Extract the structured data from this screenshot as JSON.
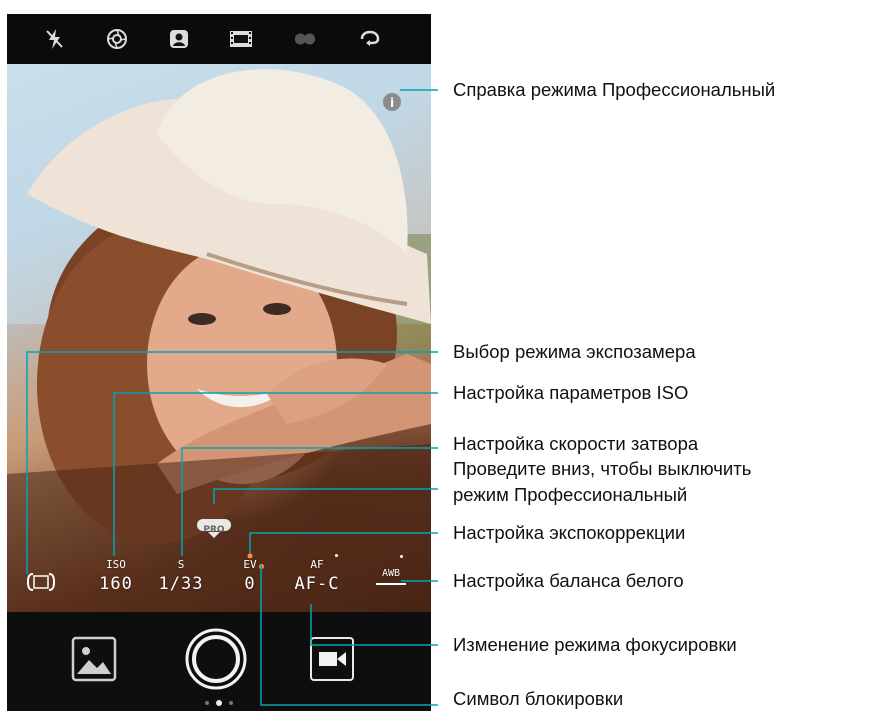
{
  "top_bar": {
    "icons": [
      "flash-off-icon",
      "aperture-icon",
      "portrait-icon",
      "film-filter-icon",
      "double-circle-icon",
      "switch-camera-icon"
    ]
  },
  "pro_controls": {
    "metering": {
      "value": "( )"
    },
    "iso": {
      "label": "ISO",
      "value": "160"
    },
    "shutter": {
      "label": "S",
      "value": "1/33"
    },
    "ev": {
      "label": "EV",
      "value": "0"
    },
    "af": {
      "label": "AF",
      "value": "AF-C"
    },
    "wb": {
      "label": "AWB"
    },
    "pro_badge": "PRO"
  },
  "callouts": {
    "pro_help": "Справка режима Профессиональный",
    "metering": "Выбор режима экспозамера",
    "iso": "Настройка параметров ISO",
    "shutter": "Настройка скорости затвора",
    "swipe_line1": "Проведите вниз, чтобы выключить",
    "swipe_line2": "режим Профессиональный",
    "ev": "Настройка экспокоррекции",
    "wb": "Настройка баланса белого",
    "focus": "Изменение режима фокусировки",
    "lock": "Символ блокировки"
  },
  "colors": {
    "callout_line": "#00a6b4",
    "accent_dot": "#ff8a3d"
  }
}
